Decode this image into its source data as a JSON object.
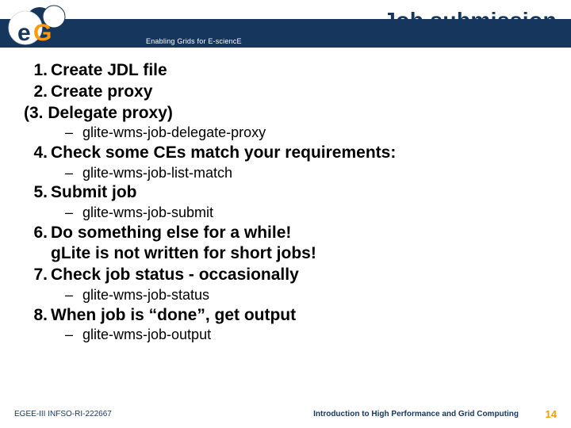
{
  "header": {
    "title": "Job submission",
    "tagline": "Enabling Grids for E-sciencE",
    "logo_text": "eGee",
    "brand_accent": "#ff9a00",
    "brand_dark": "#17365d"
  },
  "bullets": [
    {
      "type": "l1",
      "num": "1.",
      "text": "Create JDL file"
    },
    {
      "type": "l1",
      "num": "2.",
      "text": "Create proxy"
    },
    {
      "type": "l1-nonum",
      "text": "(3. Delegate proxy)"
    },
    {
      "type": "l2",
      "text": "glite-wms-job-delegate-proxy"
    },
    {
      "type": "l1",
      "num": "4.",
      "text": "Check some CEs match your requirements:"
    },
    {
      "type": "l2",
      "text": "glite-wms-job-list-match"
    },
    {
      "type": "l1",
      "num": "5.",
      "text": "Submit job"
    },
    {
      "type": "l2",
      "text": "glite-wms-job-submit"
    },
    {
      "type": "l1",
      "num": "6.",
      "text": "Do something else for a while!"
    },
    {
      "type": "l1",
      "num": "",
      "text": "gLite is not written for short jobs!"
    },
    {
      "type": "l1",
      "num": "7.",
      "text": "Check job status - occasionally"
    },
    {
      "type": "l2",
      "text": "glite-wms-job-status"
    },
    {
      "type": "l1",
      "num": "8.",
      "text": "When job is “done”, get output"
    },
    {
      "type": "l2",
      "text": "glite-wms-job-output"
    }
  ],
  "footer": {
    "left": "EGEE-III INFSO-RI-222667",
    "center": "Introduction to High Performance and Grid Computing",
    "page": "14"
  }
}
